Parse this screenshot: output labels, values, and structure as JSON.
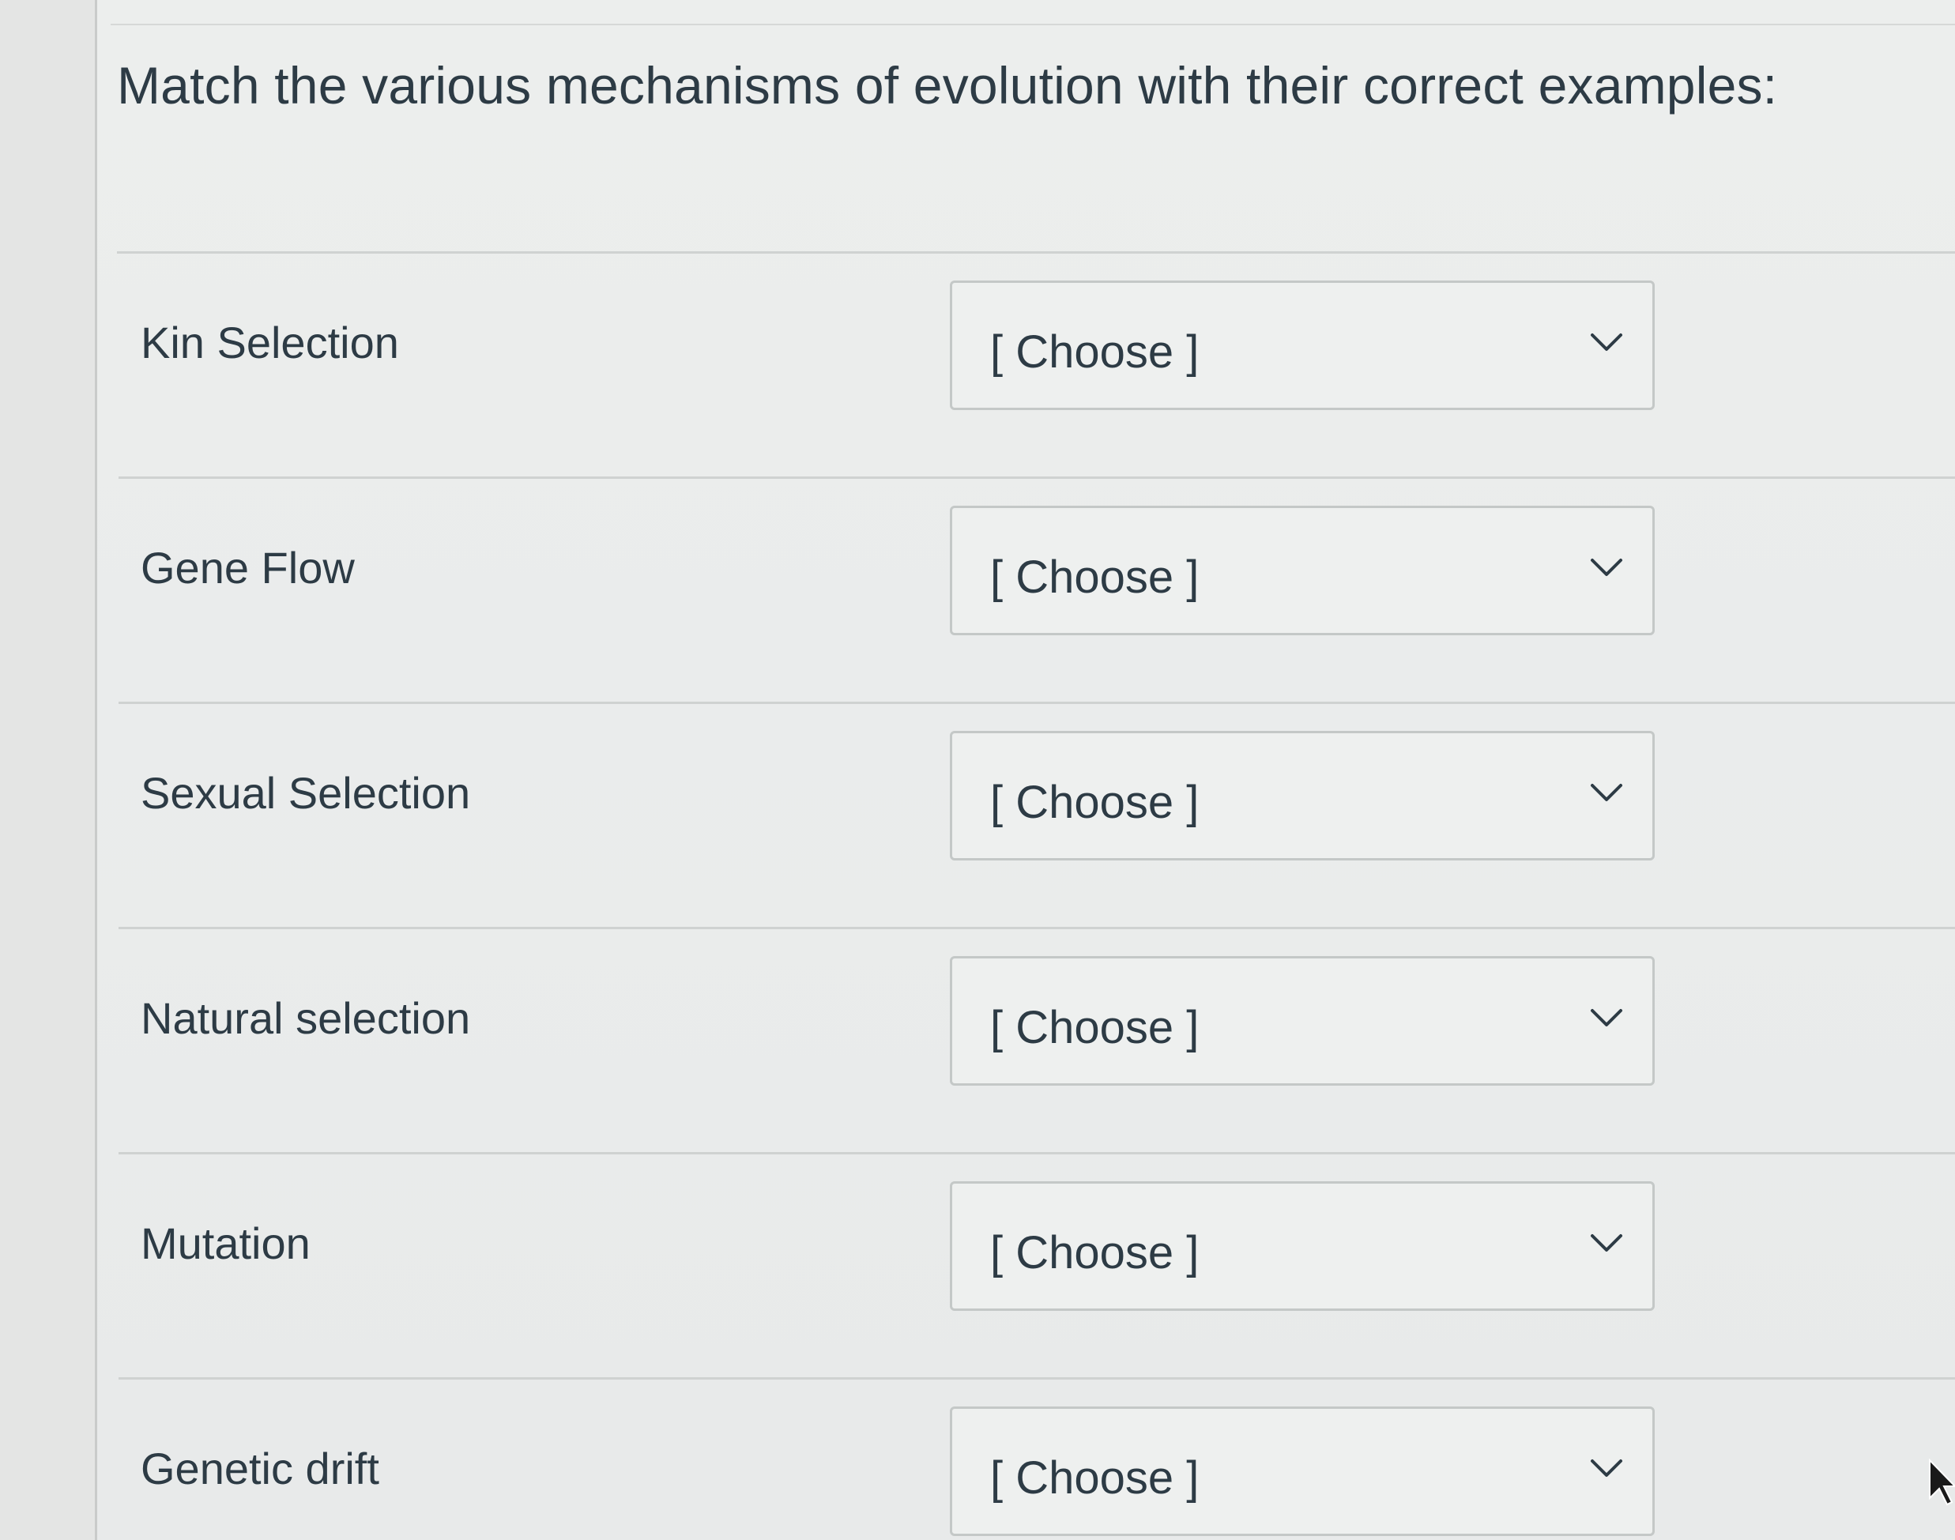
{
  "question": {
    "prompt": "Match the various mechanisms of evolution with their correct examples:"
  },
  "rows": [
    {
      "label": "Kin Selection",
      "selected": "[ Choose ]"
    },
    {
      "label": "Gene Flow",
      "selected": "[ Choose ]"
    },
    {
      "label": "Sexual Selection",
      "selected": "[ Choose ]"
    },
    {
      "label": "Natural selection",
      "selected": "[ Choose ]"
    },
    {
      "label": "Mutation",
      "selected": "[ Choose ]"
    },
    {
      "label": "Genetic drift",
      "selected": "[ Choose ]"
    }
  ],
  "colors": {
    "text": "#2d3b45",
    "border": "#c4c8c7",
    "background": "#e9ebea"
  },
  "icons": {
    "dropdown": "chevron-down-icon",
    "pointer": "mouse-cursor-icon"
  }
}
